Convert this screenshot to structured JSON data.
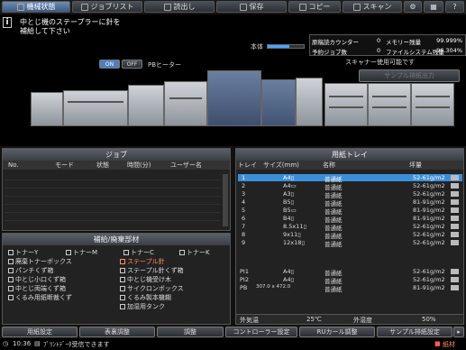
{
  "tabs": [
    {
      "label": "機械状態",
      "active": true,
      "icon": "machine-icon"
    },
    {
      "label": "ジョブリスト",
      "active": false,
      "icon": "list-icon"
    },
    {
      "label": "読出し",
      "active": false,
      "icon": "folder-icon"
    },
    {
      "label": "保存",
      "active": false,
      "icon": "save-icon"
    },
    {
      "label": "コピー",
      "active": false,
      "icon": "copy-icon"
    },
    {
      "label": "スキャン",
      "active": false,
      "icon": "scan-icon"
    }
  ],
  "message": {
    "line1": "中とじ機のステープラーに針を",
    "line2": "補給して下さい"
  },
  "counters": {
    "total_label": "原稿読カウンター",
    "total_value": "0",
    "memory_label": "メモリー残量",
    "memory_value": "99.999%",
    "reserved_label": "予約ジョブ数",
    "reserved_value": "0",
    "filesystem_label": "ファイルシステム残量",
    "filesystem_value": "96.304%"
  },
  "main_body_label": "本体",
  "scanner_status": "スキャナー使用可能です",
  "sample_output_button": "サンプル排紙出力",
  "heater": {
    "on": "ON",
    "off": "OFF",
    "label": "PBヒーター"
  },
  "job_panel": {
    "title": "ジョブ",
    "columns": [
      "No.",
      "モード",
      "状態",
      "時間(分)",
      "ユーザー名"
    ]
  },
  "supply_panel": {
    "title": "補給/廃棄部材",
    "items": [
      {
        "label": "トナーY",
        "warn": false
      },
      {
        "label": "トナーM",
        "warn": false
      },
      {
        "label": "トナーC",
        "warn": false
      },
      {
        "label": "トナーK",
        "warn": false
      },
      {
        "label": "廃棄トナーボックス",
        "warn": false
      },
      {
        "label": "ステープル針",
        "warn": true
      },
      {
        "label": "パンチくず箱",
        "warn": false
      },
      {
        "label": "ステープル針くず箱",
        "warn": false
      },
      {
        "label": "中とじ小口くず箱",
        "warn": false
      },
      {
        "label": "中とじ機受け木",
        "warn": false
      },
      {
        "label": "中とじ両端くず箱",
        "warn": false
      },
      {
        "label": "サイクロンボックス",
        "warn": false
      },
      {
        "label": "くるみ用紙断裁くず",
        "warn": false
      },
      {
        "label": "くるみ製本機糊",
        "warn": false
      },
      {
        "label": "加湿用タンク",
        "warn": false
      }
    ]
  },
  "tray_panel": {
    "title": "用紙トレイ",
    "columns": [
      "トレイ",
      "サイズ(mm)",
      "名称",
      "坪量"
    ],
    "rows": [
      {
        "tray": "1",
        "size": "A4▯",
        "name": "普通紙",
        "weight": "52-61g/m2",
        "selected": true
      },
      {
        "tray": "2",
        "size": "A4▭",
        "name": "普通紙",
        "weight": "52-61g/m2",
        "selected": false
      },
      {
        "tray": "3",
        "size": "A3▯",
        "name": "普通紙",
        "weight": "52-61g/m2",
        "selected": false
      },
      {
        "tray": "4",
        "size": "B5▯",
        "name": "普通紙",
        "weight": "81-91g/m2",
        "selected": false
      },
      {
        "tray": "5",
        "size": "B5▭",
        "name": "普通紙",
        "weight": "81-91g/m2",
        "selected": false
      },
      {
        "tray": "6",
        "size": "B4▯",
        "name": "普通紙",
        "weight": "81-91g/m2",
        "selected": false
      },
      {
        "tray": "7",
        "size": "8.5x11▯",
        "name": "普通紙",
        "weight": "52-61g/m2",
        "selected": false
      },
      {
        "tray": "8",
        "size": "9x11▯",
        "name": "普通紙",
        "weight": "52-61g/m2",
        "selected": false
      },
      {
        "tray": "9",
        "size": "12x18▯",
        "name": "普通紙",
        "weight": "52-61g/m2",
        "selected": false
      },
      {
        "tray": "PI1",
        "size": "A4▯",
        "name": "普通紙",
        "weight": "52-61g/m2",
        "selected": false
      },
      {
        "tray": "PI2",
        "size": "A4▯",
        "name": "普通紙",
        "weight": "52-61g/m2",
        "selected": false
      },
      {
        "tray": "PB",
        "size": "307.0 x 472.0",
        "name": "普通紙",
        "weight": "81-91g/m2",
        "selected": false
      }
    ]
  },
  "env": {
    "outside_temp_label": "外気温",
    "outside_temp_value": "25℃",
    "outside_humidity_label": "外湿度",
    "outside_humidity_value": "50%"
  },
  "bottom_buttons": [
    "用紙設定",
    "表裏調整",
    "調整",
    "コントローラー設定",
    "RUカール調整",
    "サンプル排紙設定"
  ],
  "status_bar": {
    "time": "10:36",
    "message": "ﾌﾟﾘﾝﾄﾃﾞｰﾀ受信できます",
    "alert": "紙材"
  },
  "colors": {
    "accent": "#3b8fd8",
    "active_tab": "#5578a3",
    "warning": "#ff8c5a"
  }
}
